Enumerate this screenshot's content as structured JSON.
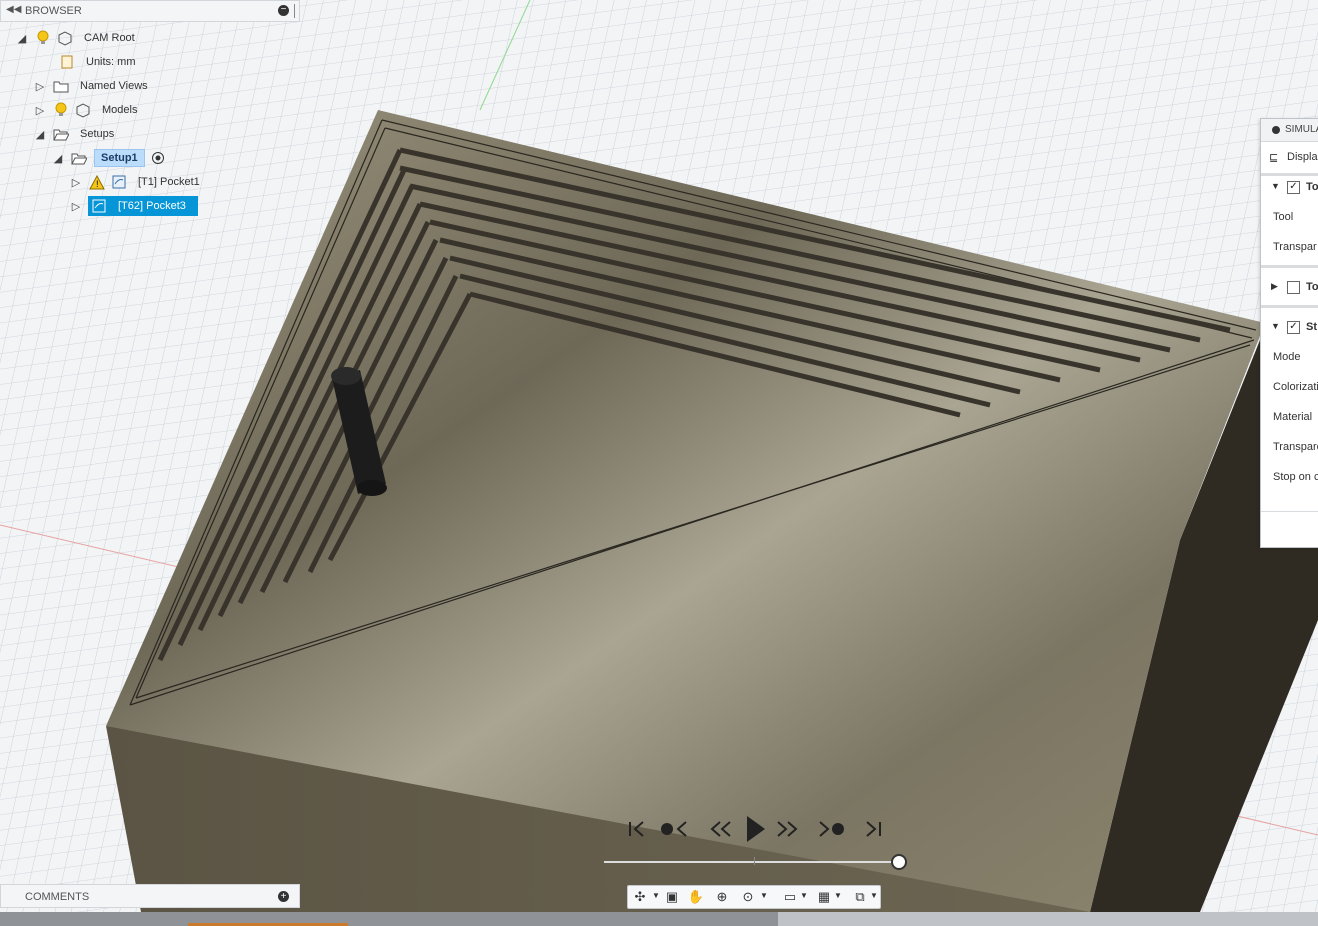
{
  "browser": {
    "title": "BROWSER",
    "items": [
      {
        "label": "CAM Root"
      },
      {
        "label": "Units: mm"
      },
      {
        "label": "Named Views"
      },
      {
        "label": "Models"
      },
      {
        "label": "Setups"
      },
      {
        "label": "Setup1"
      },
      {
        "label": "[T1] Pocket1"
      },
      {
        "label": "[T62] Pocket3"
      }
    ]
  },
  "comments": {
    "title": "COMMENTS"
  },
  "simulation_panel": {
    "title": "SIMULA",
    "rows": {
      "display": "Displa",
      "tool_group": "To",
      "tool": "Tool",
      "transparent1": "Transpar",
      "toolpath_group": "To",
      "stock_group": "St",
      "mode": "Mode",
      "colorization": "Colorizati",
      "material": "Material",
      "transparent2": "Transpare",
      "stop_on": "Stop on c"
    }
  },
  "playback": {
    "buttons": [
      "go-to-start",
      "previous-operation",
      "step-back",
      "play",
      "step-forward",
      "next-operation",
      "go-to-end"
    ],
    "progress": 1.0
  },
  "colors": {
    "selected": "#0696d7",
    "selected_label_bg": "#bcdcfb",
    "stock": "#8a8068"
  }
}
